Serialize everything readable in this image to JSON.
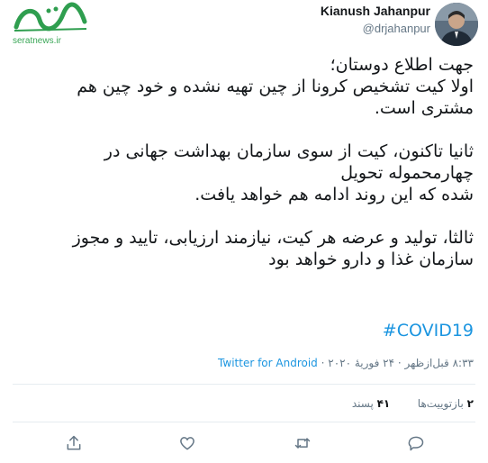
{
  "author": {
    "display_name": "Kianush Jahanpur",
    "handle": "@drjahanpur"
  },
  "watermark": {
    "site": "seratnews.ir"
  },
  "tweet": {
    "paragraphs": [
      [
        "جهت اطلاع دوستان؛",
        "اولا کیت تشخیص کرونا از چین تهیه نشده و خود چین هم",
        "مشتری است."
      ],
      [
        "ثانیا تاکنون، کیت از سوی سازمان بهداشت جهانی در",
        "چهارمحموله تحویل",
        "شده که این روند ادامه هم خواهد یافت."
      ],
      [
        "ثالثا، تولید و عرضه هر کیت، نیازمند ارزیابی، تایید و مجوز",
        "سازمان غذا و دارو خواهد بود"
      ]
    ],
    "hashtag": "#COVID19"
  },
  "meta": {
    "time_date": "۸:۳۳ قبل‌ازظهر · ۲۴ فوریهٔ ۲۰۲۰",
    "separator": " · ",
    "source": "Twitter for Android"
  },
  "stats": {
    "retweets_count": "۲",
    "retweets_label": "بازتوییت‌ها",
    "likes_count": "۴۱",
    "likes_label": "پسند"
  },
  "actions": [
    "share-icon",
    "heart-icon",
    "retweet-icon",
    "reply-icon"
  ],
  "colors": {
    "link": "#1b95e0",
    "secondary_text": "#657786",
    "divider": "#e6ecf0",
    "watermark_green": "#3aa757"
  }
}
